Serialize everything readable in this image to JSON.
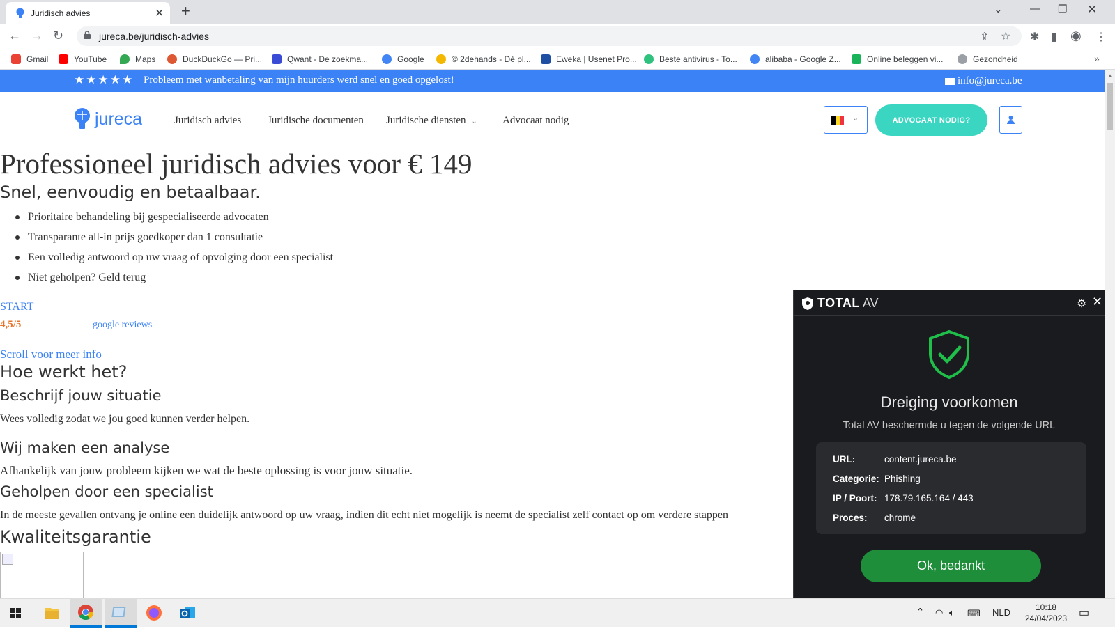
{
  "browser": {
    "tab_title": "Juridisch advies",
    "url": "jureca.be/juridisch-advies",
    "bookmarks": [
      {
        "label": "Gmail",
        "color": "#ea4335"
      },
      {
        "label": "YouTube",
        "color": "#ff0000"
      },
      {
        "label": "Maps",
        "color": "#34a853"
      },
      {
        "label": "DuckDuckGo — Pri...",
        "color": "#de5833"
      },
      {
        "label": "Qwant - De zoekma...",
        "color": "#3a4bd6"
      },
      {
        "label": "Google",
        "color": "#4285f4"
      },
      {
        "label": "© 2dehands - Dé pl...",
        "color": "#f5b800"
      },
      {
        "label": "Eweka | Usenet Pro...",
        "color": "#1f4fa3"
      },
      {
        "label": "Beste antivirus - To...",
        "color": "#2ec27e"
      },
      {
        "label": "alibaba - Google Z...",
        "color": "#4285f4"
      },
      {
        "label": "Online beleggen vi...",
        "color": "#19b35a"
      },
      {
        "label": "Gezondheid",
        "color": "#9aa0a6"
      }
    ]
  },
  "site": {
    "promo_stars": "★★★★★",
    "promo_text": "Probleem met wanbetaling van mijn huurders werd snel en goed opgelost!",
    "email": "info@jureca.be",
    "logo": "jureca",
    "nav": [
      "Juridisch advies",
      "Juridische documenten",
      "Juridische diensten",
      "Advocaat nodig"
    ],
    "cta": "ADVOCAAT NODIG?",
    "brand_color": "#3b82f6",
    "cta_color": "#3ad6c2"
  },
  "main": {
    "title": "Professioneel juridisch advies voor € 149",
    "subtitle": "Snel, eenvoudig en betaalbaar.",
    "bullets": [
      "Prioritaire behandeling bij gespecialiseerde advocaten",
      "Transparante all-in prijs goedkoper dan 1 consultatie",
      "Een volledig antwoord op uw vraag of opvolging door een specialist",
      "Niet geholpen? Geld terug"
    ],
    "start": "START",
    "rating": "4,5/5",
    "reviews": "google reviews",
    "scroll": "Scroll voor meer info",
    "how_title": "Hoe werkt het?",
    "step1_title": "Beschrijf jouw situatie",
    "step1_text": "Wees volledig zodat we jou goed kunnen verder helpen.",
    "step2_title": "Wij maken een analyse",
    "step2_text": "Afhankelijk van jouw probleem kijken we wat de beste oplossing is voor jouw situatie.",
    "step3_title": "Geholpen door een specialist",
    "step3_text": "In de meeste gevallen ontvang je online een duidelijk antwoord op uw vraag, indien dit echt niet mogelijk is neemt de specialist zelf contact op om verdere stappen",
    "quality_title": "Kwaliteitsgarantie"
  },
  "popup": {
    "brand_bold": "TOTAL",
    "brand_light": "AV",
    "heading": "Dreiging voorkomen",
    "subtext": "Total AV beschermde u tegen de volgende URL",
    "rows": [
      {
        "key": "URL:",
        "value": "content.jureca.be"
      },
      {
        "key": "Categorie:",
        "value": "Phishing"
      },
      {
        "key": "IP / Poort:",
        "value": "178.79.165.164 / 443"
      },
      {
        "key": "Proces:",
        "value": "chrome"
      }
    ],
    "button": "Ok, bedankt",
    "accent": "#1fbf4a"
  },
  "taskbar": {
    "lang": "NLD",
    "time": "10:18",
    "date": "24/04/2023"
  }
}
